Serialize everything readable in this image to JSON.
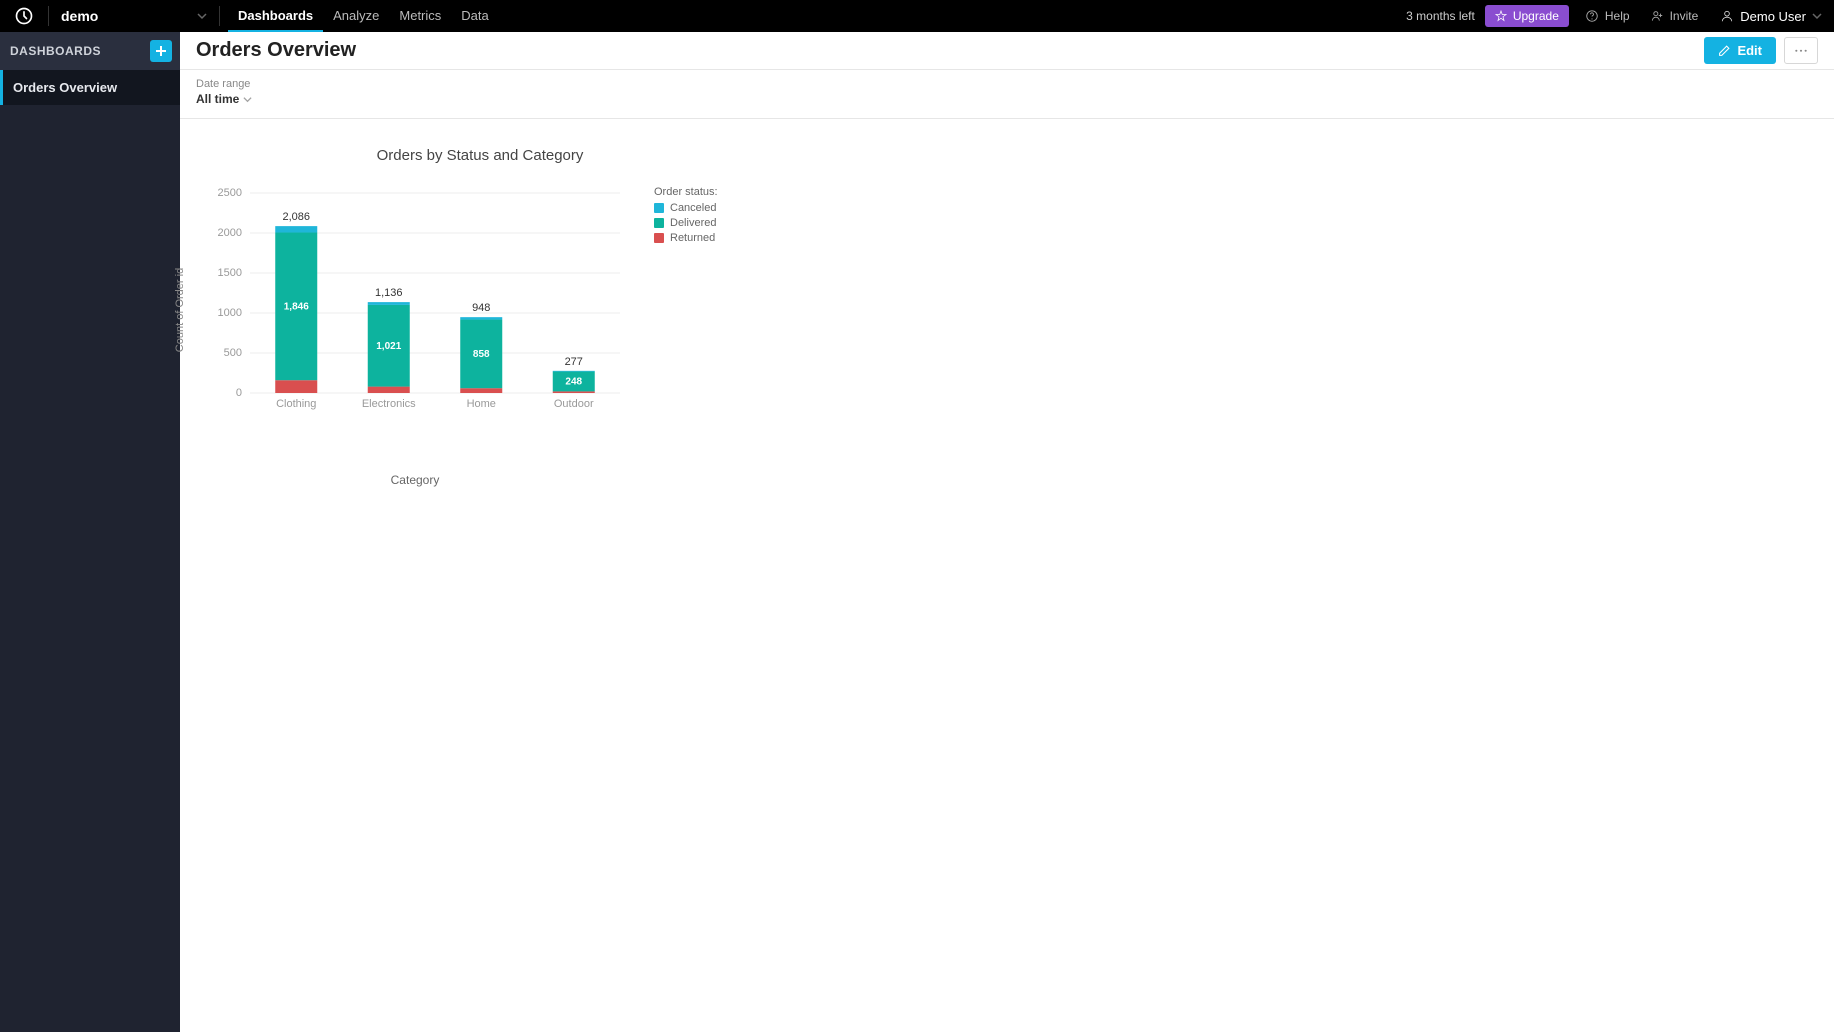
{
  "topbar": {
    "workspace": "demo",
    "tabs": [
      {
        "label": "Dashboards",
        "active": true
      },
      {
        "label": "Analyze",
        "active": false
      },
      {
        "label": "Metrics",
        "active": false
      },
      {
        "label": "Data",
        "active": false
      }
    ],
    "trial_text": "3 months left",
    "upgrade_label": "Upgrade",
    "help_label": "Help",
    "invite_label": "Invite",
    "user_name": "Demo User"
  },
  "sidebar": {
    "section_title": "DASHBOARDS",
    "items": [
      {
        "label": "Orders Overview",
        "active": true
      }
    ]
  },
  "page": {
    "title": "Orders Overview",
    "edit_label": "Edit"
  },
  "filter": {
    "label": "Date range",
    "value": "All time"
  },
  "chart": {
    "title": "Orders by Status and Category",
    "ylabel": "Count of Order id",
    "xlabel": "Category",
    "legend_title": "Order status:",
    "legend": [
      {
        "name": "Canceled",
        "color": "#1fb6d9"
      },
      {
        "name": "Delivered",
        "color": "#0db39e"
      },
      {
        "name": "Returned",
        "color": "#d94f4f"
      }
    ]
  },
  "chart_data": {
    "type": "bar",
    "stacked": true,
    "categories": [
      "Clothing",
      "Electronics",
      "Home",
      "Outdoor"
    ],
    "series": [
      {
        "name": "Returned",
        "color": "#d94f4f",
        "values": [
          160,
          80,
          60,
          20
        ]
      },
      {
        "name": "Delivered",
        "color": "#0db39e",
        "values": [
          1846,
          1021,
          858,
          248
        ]
      },
      {
        "name": "Canceled",
        "color": "#1fb6d9",
        "values": [
          80,
          35,
          30,
          9
        ]
      }
    ],
    "totals": [
      2086,
      1136,
      948,
      277
    ],
    "segment_labels": [
      {
        "category": 0,
        "series": 1,
        "text": "1,846"
      },
      {
        "category": 1,
        "series": 1,
        "text": "1,021"
      },
      {
        "category": 2,
        "series": 1,
        "text": "858"
      },
      {
        "category": 3,
        "series": 1,
        "text": "248"
      }
    ],
    "total_labels": [
      "2,086",
      "1,136",
      "948",
      "277"
    ],
    "ylim": [
      0,
      2500
    ],
    "yticks": [
      0,
      500,
      1000,
      1500,
      2000,
      2500
    ],
    "xlabel": "Category",
    "ylabel": "Count of Order id",
    "title": "Orders by Status and Category"
  }
}
